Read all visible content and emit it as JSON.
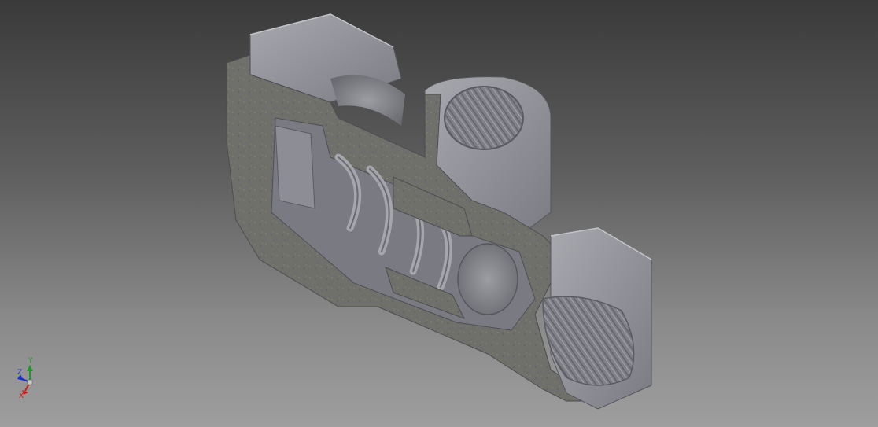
{
  "viewport": {
    "background_top": "#3a3a3a",
    "background_bottom": "#9e9e9e"
  },
  "model": {
    "description_icon": "section-view-valve-body",
    "face_color": "#8c8d94",
    "cut_color": "#6e6f6a",
    "highlight_color": "#b3b4ba",
    "shadow_color": "#5a5b60"
  },
  "triad": {
    "x_label": "X",
    "y_label": "Y",
    "z_label": "Z",
    "x_color": "#d01a1a",
    "y_color": "#1f9a2a",
    "z_color": "#1c2fd0"
  }
}
